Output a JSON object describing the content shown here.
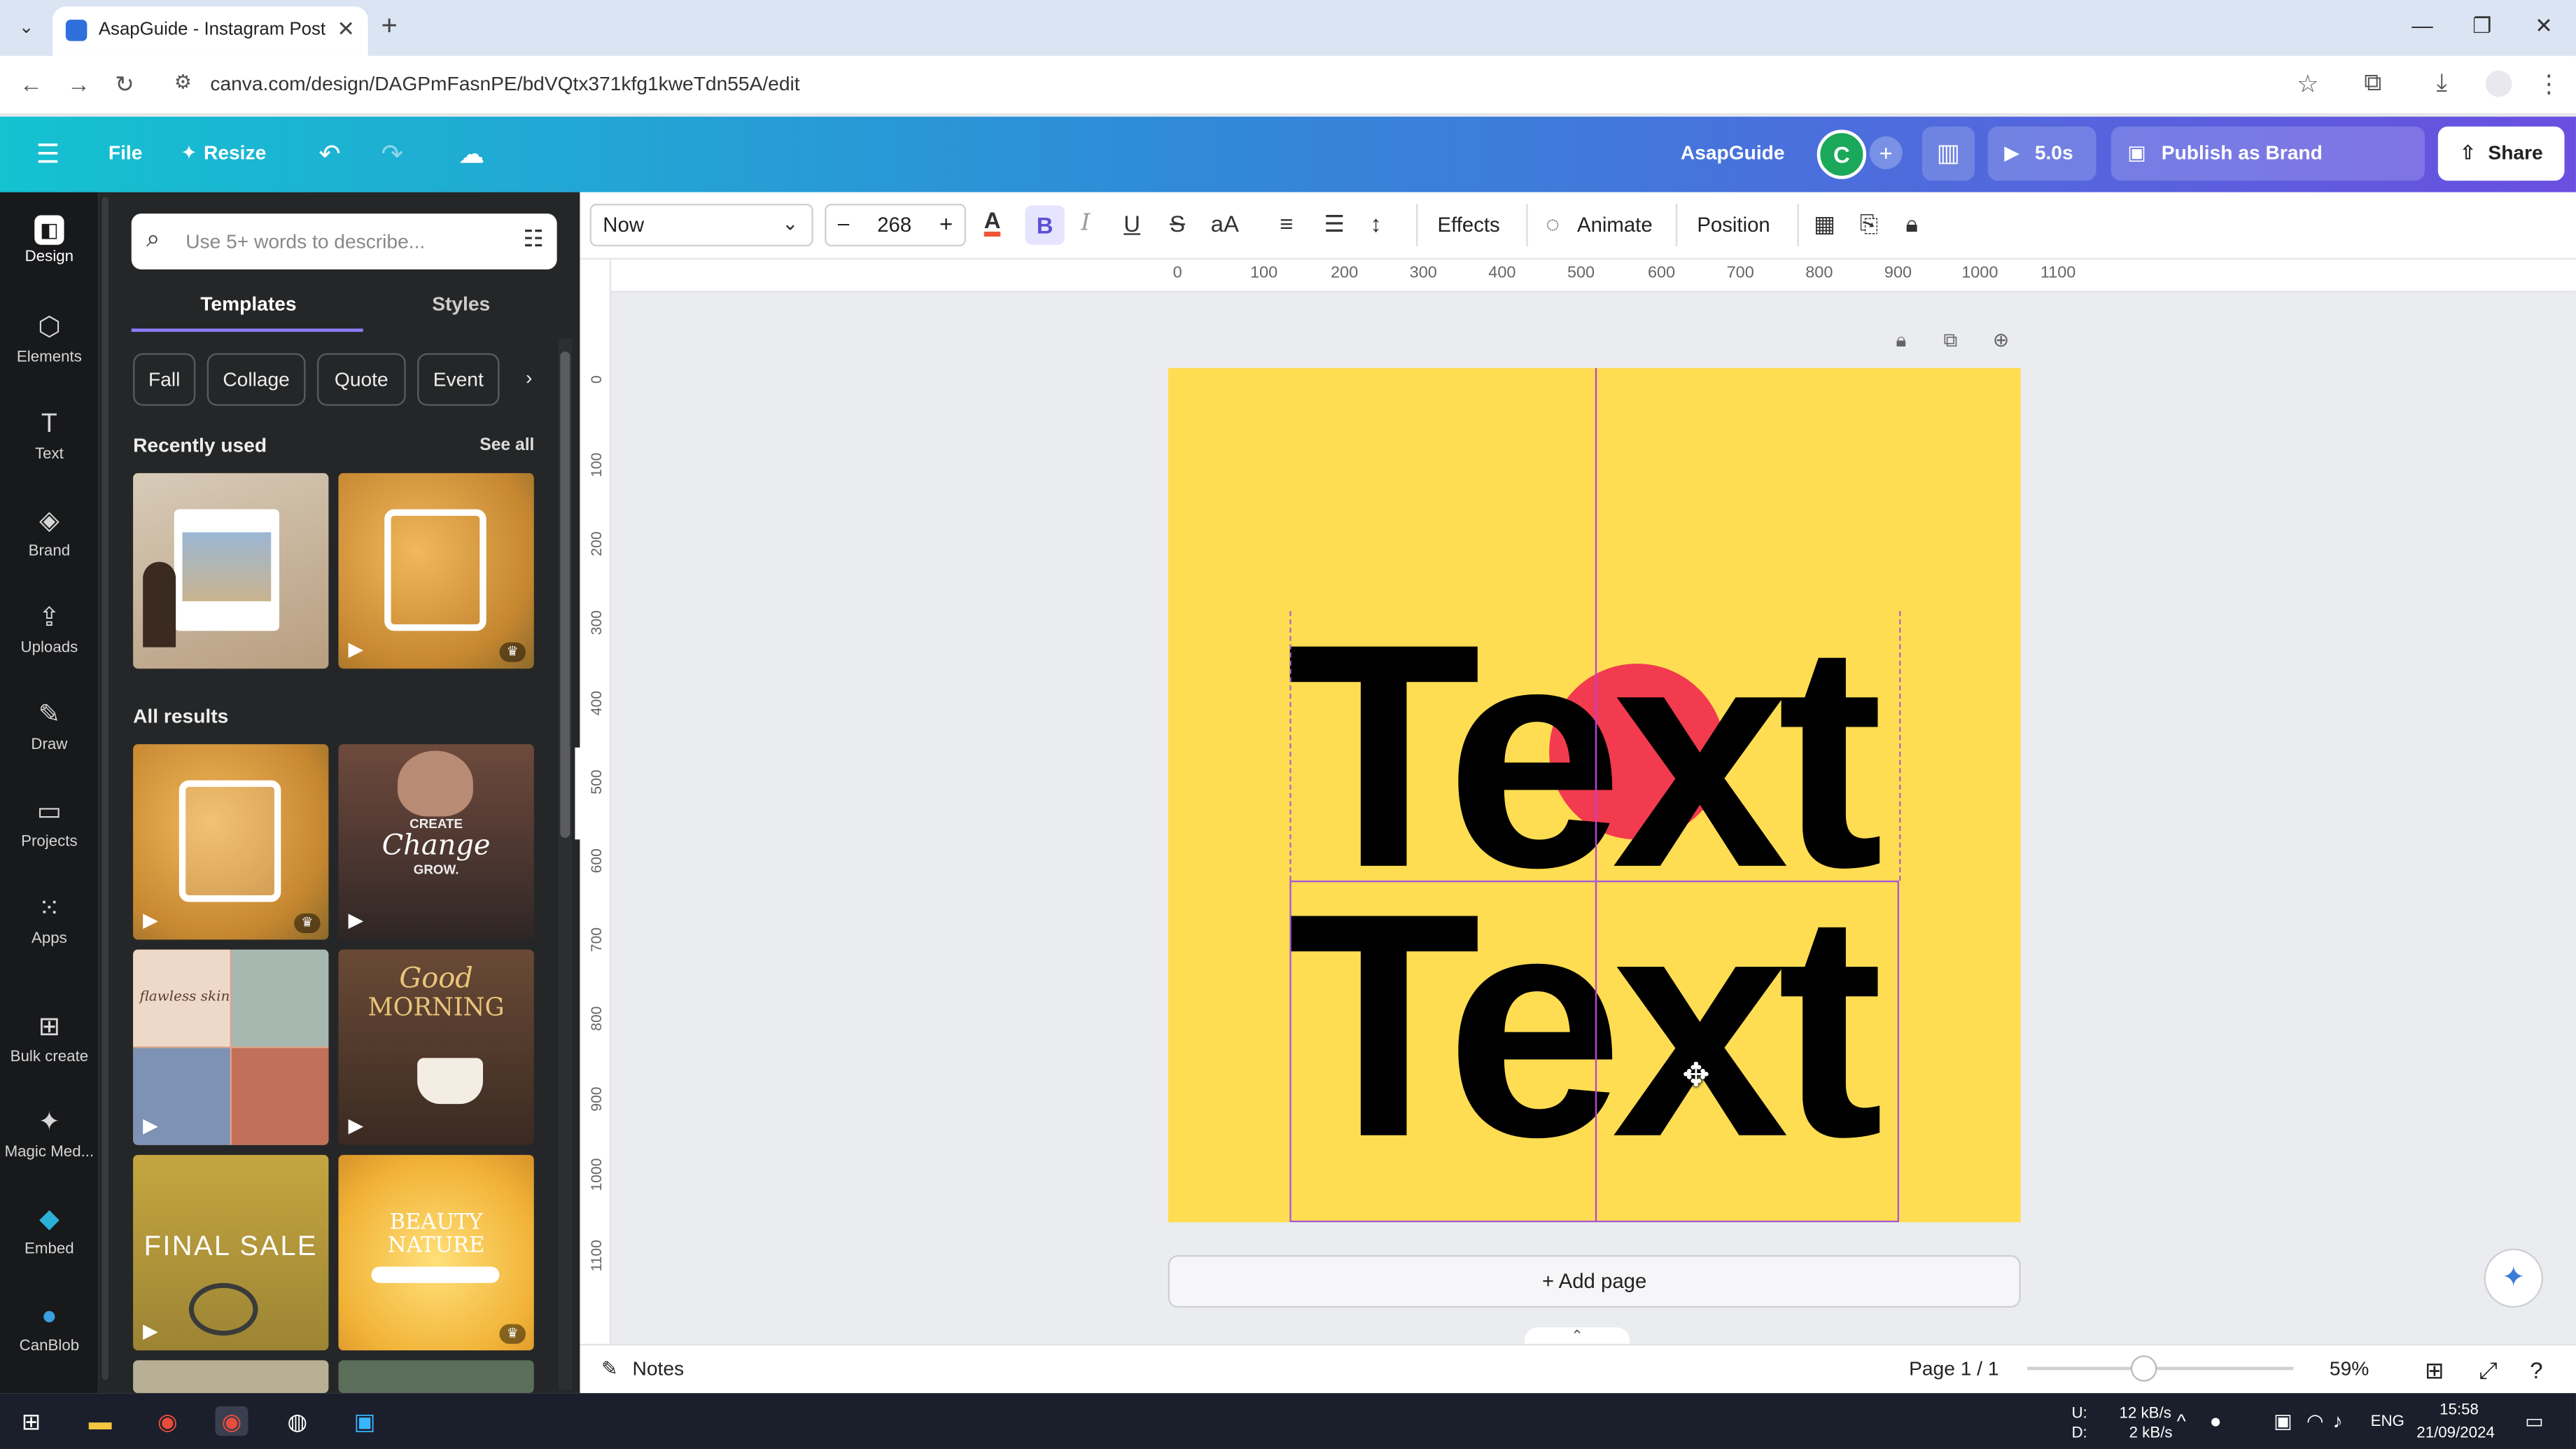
{
  "browser": {
    "tab_title": "AsapGuide - Instagram Post",
    "tab_close": "✕",
    "new_tab": "+",
    "url": "canva.com/design/DAGPmFasnPE/bdVQtx371kfg1kweTdn55A/edit"
  },
  "header": {
    "menu_icon": "menu-icon",
    "file": "File",
    "resize": "Resize",
    "brand_name": "AsapGuide",
    "avatar_letter": "C",
    "duration": "5.0s",
    "publish": "Publish as Brand Template",
    "share": "Share"
  },
  "rail": {
    "items": [
      {
        "label": "Design",
        "icon": "design-icon"
      },
      {
        "label": "Elements",
        "icon": "elements-icon"
      },
      {
        "label": "Text",
        "icon": "text-icon"
      },
      {
        "label": "Brand",
        "icon": "brand-icon"
      },
      {
        "label": "Uploads",
        "icon": "uploads-icon"
      },
      {
        "label": "Draw",
        "icon": "draw-icon"
      },
      {
        "label": "Projects",
        "icon": "projects-icon"
      },
      {
        "label": "Apps",
        "icon": "apps-icon"
      },
      {
        "label": "Bulk create",
        "icon": "bulk-create-icon"
      },
      {
        "label": "Magic Med...",
        "icon": "magic-media-icon"
      },
      {
        "label": "Embed",
        "icon": "embed-icon"
      },
      {
        "label": "CanBlob",
        "icon": "canblob-icon"
      }
    ]
  },
  "panel": {
    "search_placeholder": "Use 5+ words to describe...",
    "tabs": [
      "Templates",
      "Styles"
    ],
    "chips": [
      "Fall",
      "Collage",
      "Quote",
      "Event"
    ],
    "recently_used": "Recently used",
    "see_all": "See all",
    "all_results": "All results",
    "thumb_texts": {
      "create": "CREATE",
      "change": "Change",
      "grow": "GROW.",
      "flawless": "flawless skin",
      "good": "Good",
      "morning": "MORNING",
      "final_sale": "FINAL SALE",
      "beauty": "BEAUTY",
      "nature": "NATURE"
    }
  },
  "toolbar": {
    "font": "Now",
    "size": "268",
    "minus": "–",
    "plus": "+",
    "effects": "Effects",
    "animate": "Animate",
    "position": "Position",
    "bold": "B"
  },
  "rulers": {
    "h": [
      "0",
      "100",
      "200",
      "300",
      "400",
      "500",
      "600",
      "700",
      "800",
      "900",
      "1000",
      "1100"
    ],
    "v": [
      "0",
      "100",
      "200",
      "300",
      "400",
      "500",
      "600",
      "700",
      "800",
      "900",
      "1000",
      "1100"
    ]
  },
  "canvas": {
    "line1": "Text",
    "line2": "Text",
    "bg_color": "#ffdd52",
    "circle_color": "#f23b4e",
    "add_page": "+ Add page"
  },
  "status": {
    "notes": "Notes",
    "page": "Page 1 / 1",
    "zoom": "59%",
    "zoom_level": 0.44
  },
  "taskbar": {
    "net_up_label": "U:",
    "net_down_label": "D:",
    "net_up": "12 kB/s",
    "net_down": "2 kB/s",
    "lang": "ENG",
    "time": "15:58",
    "date": "21/09/2024"
  }
}
